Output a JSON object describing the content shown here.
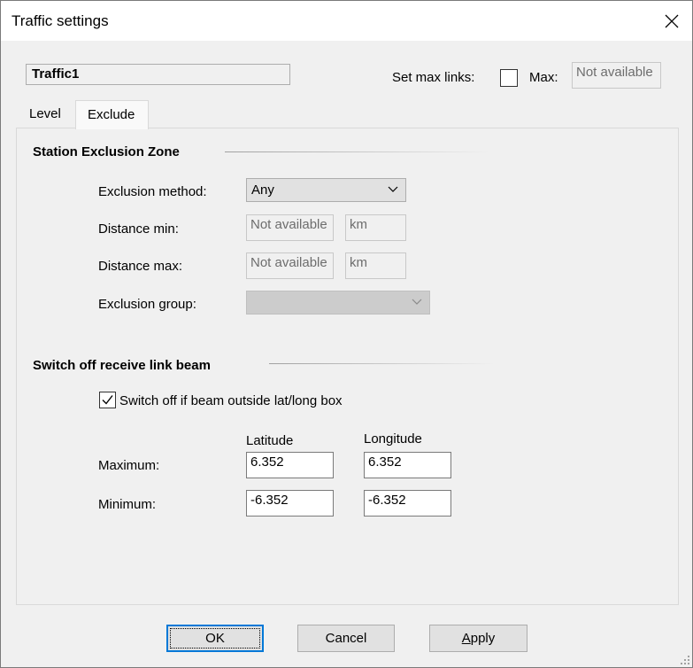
{
  "window": {
    "title": "Traffic settings"
  },
  "header": {
    "name": "Traffic1",
    "set_max_links_label": "Set max links:",
    "max_label": "Max:",
    "max_value": "Not available",
    "max_links_checked": false
  },
  "tabs": [
    {
      "label": "Level",
      "active": false
    },
    {
      "label": "Exclude",
      "active": true
    }
  ],
  "station_exclusion": {
    "title": "Station Exclusion Zone",
    "method_label": "Exclusion method:",
    "method_value": "Any",
    "distance_min_label": "Distance min:",
    "distance_min_value": "Not available",
    "distance_min_unit": "km",
    "distance_max_label": "Distance max:",
    "distance_max_value": "Not available",
    "distance_max_unit": "km",
    "group_label": "Exclusion group:",
    "group_value": ""
  },
  "switch_off": {
    "title": "Switch off receive link beam",
    "checkbox_label": "Switch off if beam outside lat/long box",
    "checked": true,
    "latitude_header": "Latitude",
    "longitude_header": "Longitude",
    "maximum_label": "Maximum:",
    "minimum_label": "Minimum:",
    "max_latitude": "6.352",
    "max_longitude": "6.352",
    "min_latitude": "-6.352",
    "min_longitude": "-6.352"
  },
  "buttons": {
    "ok": "OK",
    "cancel": "Cancel",
    "apply": "Apply",
    "apply_mnemonic": "A",
    "apply_rest": "pply"
  },
  "icons": {
    "close": "close-icon",
    "dropdown": "chevron-down-icon",
    "check": "checkmark-icon",
    "resize": "resize-grip-icon"
  },
  "colors": {
    "window_bg": "#f0f0f0",
    "default_button_border": "#0078d7",
    "disabled_text": "#6d6d6d"
  }
}
